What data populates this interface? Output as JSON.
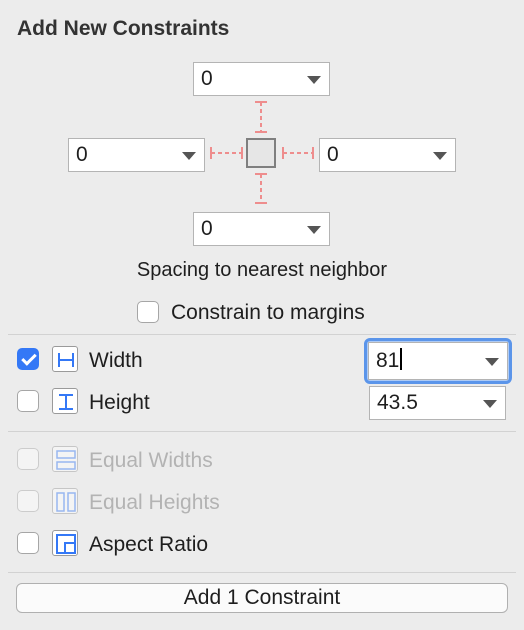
{
  "panel": {
    "title": "Add New Constraints",
    "spacing_caption": "Spacing to nearest neighbor",
    "add_button_label": "Add 1 Constraint"
  },
  "spacing": {
    "top": "0",
    "left": "0",
    "right": "0",
    "bottom": "0"
  },
  "margins": {
    "label": "Constrain to margins",
    "checked": false
  },
  "size": {
    "width": {
      "label": "Width",
      "checked": true,
      "value": "81",
      "icon": "width-icon"
    },
    "height": {
      "label": "Height",
      "checked": false,
      "value": "43.5",
      "icon": "height-icon"
    }
  },
  "relations": {
    "equal_widths": {
      "label": "Equal Widths",
      "enabled": false,
      "icon": "equal-widths-icon"
    },
    "equal_heights": {
      "label": "Equal Heights",
      "enabled": false,
      "icon": "equal-heights-icon"
    },
    "aspect_ratio": {
      "label": "Aspect Ratio",
      "enabled": true,
      "icon": "aspect-ratio-icon"
    }
  },
  "colors": {
    "accent": "#3478f6",
    "strut": "#ee8d8d"
  }
}
